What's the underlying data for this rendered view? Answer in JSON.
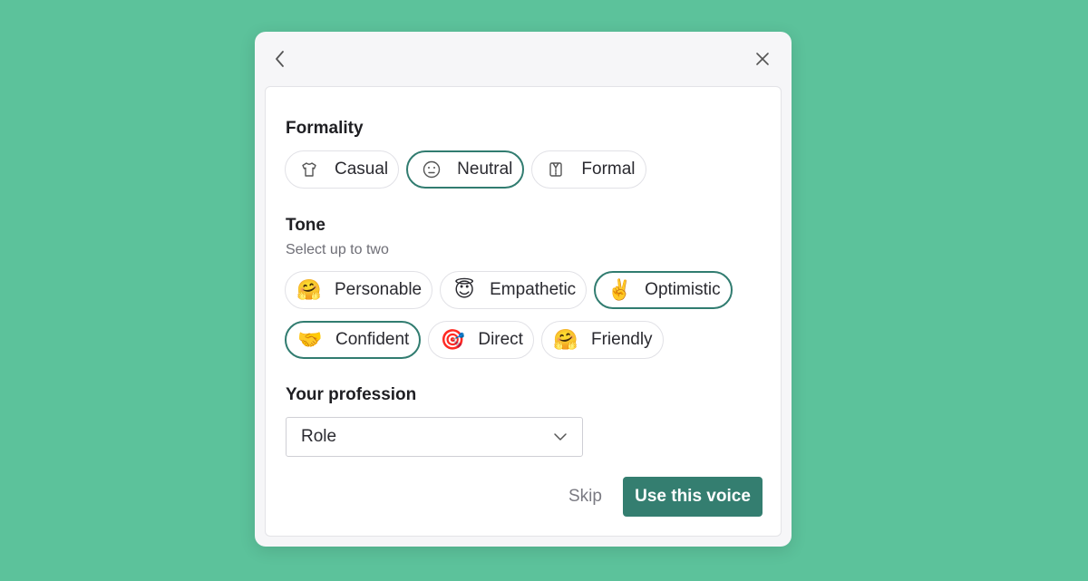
{
  "formality": {
    "title": "Formality",
    "options": [
      {
        "label": "Casual",
        "icon": "tshirt-icon",
        "selected": false
      },
      {
        "label": "Neutral",
        "icon": "neutral-face-icon",
        "selected": true
      },
      {
        "label": "Formal",
        "icon": "suit-icon",
        "selected": false
      }
    ]
  },
  "tone": {
    "title": "Tone",
    "subtitle": "Select up to two",
    "options": [
      {
        "label": "Personable",
        "emoji": "🤗",
        "icon": "hugging-face-icon",
        "selected": false
      },
      {
        "label": "Empathetic",
        "emoji": "😇",
        "icon": "smiling-halo-face-icon",
        "selected": false
      },
      {
        "label": "Optimistic",
        "emoji": "✌️",
        "icon": "victory-hand-icon",
        "selected": true
      },
      {
        "label": "Confident",
        "emoji": "🤝",
        "icon": "handshake-icon",
        "selected": true
      },
      {
        "label": "Direct",
        "emoji": "🎯",
        "icon": "target-icon",
        "selected": false
      },
      {
        "label": "Friendly",
        "emoji": "🤗",
        "icon": "hugging-face-icon",
        "selected": false
      }
    ]
  },
  "profession": {
    "title": "Your profession",
    "select_value": "Role"
  },
  "actions": {
    "skip_label": "Skip",
    "primary_label": "Use this voice"
  },
  "colors": {
    "background": "#5cc29b",
    "accent": "#347e70",
    "selected_border": "#317c70"
  }
}
